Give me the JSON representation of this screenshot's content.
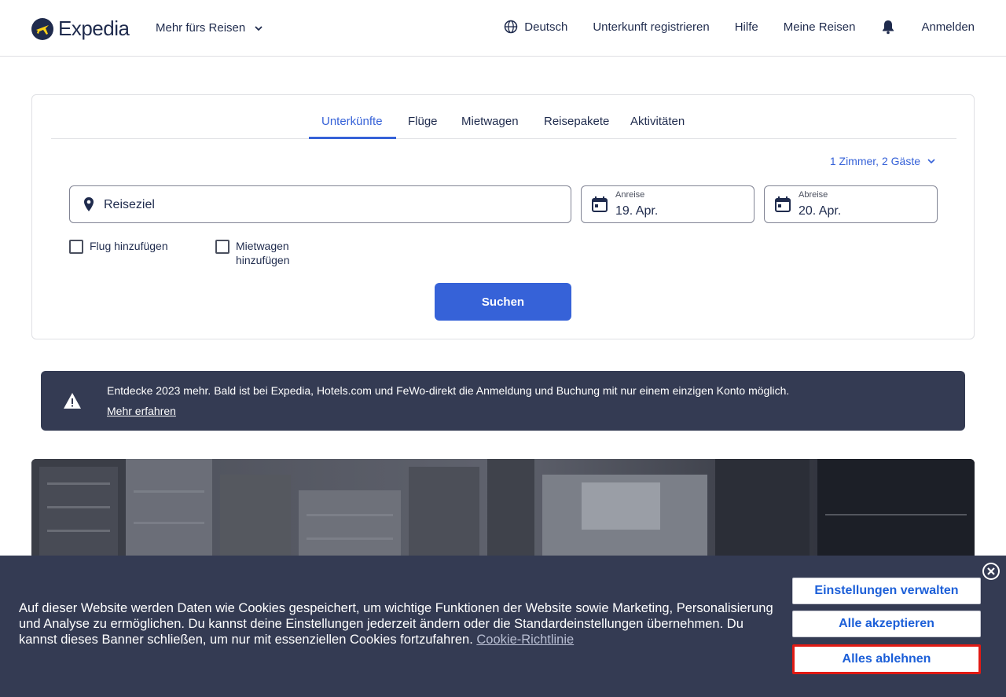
{
  "header": {
    "logo_text": "Expedia",
    "more_travel": "Mehr fürs Reisen",
    "language": "Deutsch",
    "register_property": "Unterkunft registrieren",
    "help": "Hilfe",
    "my_trips": "Meine Reisen",
    "sign_in": "Anmelden"
  },
  "search": {
    "tabs": [
      {
        "label": "Unterkünfte",
        "active": true
      },
      {
        "label": "Flüge",
        "active": false
      },
      {
        "label": "Mietwagen",
        "active": false
      },
      {
        "label": "Reisepakete",
        "active": false
      },
      {
        "label": "Aktivitäten",
        "active": false
      }
    ],
    "guests": "1 Zimmer, 2 Gäste",
    "destination_placeholder": "Reiseziel",
    "checkin_label": "Anreise",
    "checkin_value": "19. Apr.",
    "checkout_label": "Abreise",
    "checkout_value": "20. Apr.",
    "add_flight": "Flug hinzufügen",
    "add_car": "Mietwagen hinzufügen",
    "search_button": "Suchen"
  },
  "info_banner": {
    "text": "Entdecke 2023 mehr. Bald ist bei Expedia, Hotels.com und FeWo-direkt die Anmeldung und Buchung mit nur einem einzigen Konto möglich.",
    "link": "Mehr erfahren"
  },
  "cookie_banner": {
    "text": "Auf dieser Website werden Daten wie Cookies gespeichert, um wichtige Funktionen der Website sowie Marketing, Personalisierung und Analyse zu ermöglichen. Du kannst deine Einstellungen jederzeit ändern oder die Standardeinstellungen übernehmen. Du kannst dieses Banner schließen, um nur mit essenziellen Cookies fortzufahren.",
    "policy_link": "Cookie-Richtlinie",
    "manage_button": "Einstellungen verwalten",
    "accept_button": "Alle akzeptieren",
    "reject_button": "Alles ablehnen"
  },
  "colors": {
    "brand_dark": "#1f2b4d",
    "accent": "#3662d8",
    "banner_bg": "#343b53",
    "highlight": "#e11a14"
  }
}
